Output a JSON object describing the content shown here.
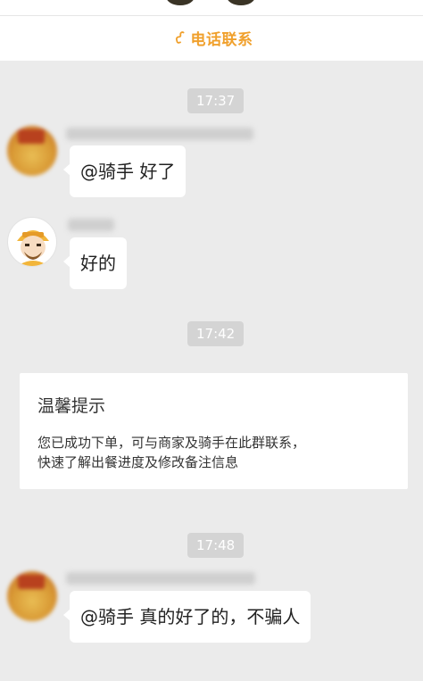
{
  "header": {
    "phone_label": "电话联系",
    "accent_color": "#f0a02c",
    "phone_icon": "phone-icon"
  },
  "timestamps": [
    "17:37",
    "17:42",
    "17:48"
  ],
  "messages": [
    {
      "sender": "shop",
      "avatar_icon": "shop-avatar",
      "text": "@骑手 好了"
    },
    {
      "sender": "rider",
      "avatar_icon": "rider-avatar",
      "text": "好的"
    },
    {
      "sender": "shop",
      "avatar_icon": "shop-avatar",
      "text": "@骑手 真的好了的，不骗人"
    }
  ],
  "tip": {
    "title": "温馨提示",
    "line1": "您已成功下单，可与商家及骑手在此群联系，",
    "line2": "快速了解出餐进度及修改备注信息"
  }
}
